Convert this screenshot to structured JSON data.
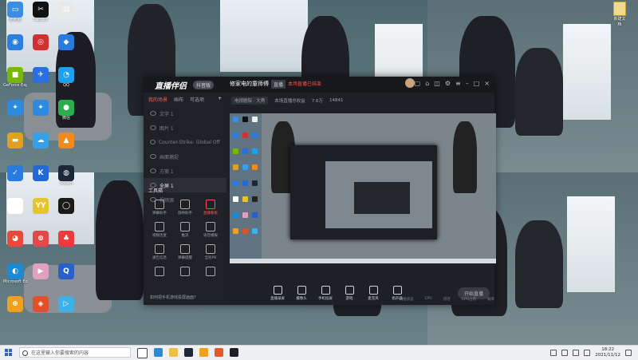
{
  "desktop": {
    "icons": [
      {
        "label": "此电脑",
        "color": "#3a8de0",
        "glyph": "▭"
      },
      {
        "label": "CapCut",
        "color": "#111111",
        "glyph": "✂"
      },
      {
        "label": "",
        "color": "#e8e8e8",
        "glyph": "▤"
      },
      {
        "label": "",
        "color": "#2b7de0",
        "glyph": "◉"
      },
      {
        "label": "",
        "color": "#d03030",
        "glyph": "◎"
      },
      {
        "label": "",
        "color": "#2a7be0",
        "glyph": "◆"
      },
      {
        "label": "GeForce Experience",
        "color": "#76b900",
        "glyph": "■"
      },
      {
        "label": "",
        "color": "#2a6fe0",
        "glyph": "✈"
      },
      {
        "label": "QQ",
        "color": "#1ea0f0",
        "glyph": "◔"
      },
      {
        "label": "",
        "color": "#2c8ae0",
        "glyph": "✦"
      },
      {
        "label": "",
        "color": "#2c8ae0",
        "glyph": "✦"
      },
      {
        "label": "微信",
        "color": "#2aae4e",
        "glyph": "●"
      },
      {
        "label": "",
        "color": "#e0a020",
        "glyph": "▬"
      },
      {
        "label": "",
        "color": "#36a0e8",
        "glyph": "☁"
      },
      {
        "label": "",
        "color": "#f08a1c",
        "glyph": "▲"
      },
      {
        "label": "",
        "color": "#2a7be0",
        "glyph": "✓"
      },
      {
        "label": "",
        "color": "#2468d8",
        "glyph": "K"
      },
      {
        "label": "Steam",
        "color": "#1b2838",
        "glyph": "◍"
      },
      {
        "label": "",
        "color": "#ffffff",
        "glyph": "✿"
      },
      {
        "label": "",
        "color": "#e6c42a",
        "glyph": "YY"
      },
      {
        "label": "",
        "color": "#1a1a1a",
        "glyph": "◯"
      },
      {
        "label": "",
        "color": "#e84a3a",
        "glyph": "◕"
      },
      {
        "label": "",
        "color": "#e24a4a",
        "glyph": "⊚"
      },
      {
        "label": "",
        "color": "#eb3b3b",
        "glyph": "♣"
      },
      {
        "label": "Microsoft Edge",
        "color": "#1a8ad4",
        "glyph": "◐"
      },
      {
        "label": "",
        "color": "#e0a0c0",
        "glyph": "▶"
      },
      {
        "label": "",
        "color": "#2a5ec8",
        "glyph": "Q"
      },
      {
        "label": "",
        "color": "#f0a020",
        "glyph": "⊕"
      },
      {
        "label": "",
        "color": "#e0502a",
        "glyph": "◈"
      },
      {
        "label": "",
        "color": "#3fb0e8",
        "glyph": "▷"
      }
    ],
    "corner_icon_label": "新建文档"
  },
  "app": {
    "logo": "直播伴侣",
    "version_badge": "抖音版",
    "project_title": "修家电的童师傅",
    "tag1": "直播",
    "tag2": "本场直播已结束",
    "left_tabs": [
      "我的场景",
      "画布",
      "可选项"
    ],
    "scenes": [
      "文字 1",
      "图片 1",
      "Counter-Strike: Global Offensive",
      "画面捕捉",
      "方案 1",
      "全屏 1",
      "视频源"
    ],
    "toolbox_title": "工具箱",
    "tools": [
      "弹幕助手",
      "放映助手",
      "直播看板",
      "视频连麦",
      "推流",
      "语音播报",
      "通告信息",
      "弹幕提醒",
      "全民PK",
      "",
      "",
      ""
    ],
    "left_bottom_hint": "如何把手机游戏投屏画面?",
    "infobar": {
      "left": "电视剧院 · 大秀",
      "mid": "本场直播总收益",
      "viewers": "7.6万",
      "likes": "14841"
    },
    "bottom_buttons": [
      "直播录屏",
      "摄像头",
      "手机投屏",
      "游戏",
      "麦克风",
      "扬声器"
    ],
    "live_button": "开始直播",
    "status_items": [
      "网络状态",
      "CPU",
      "内存",
      "CPU占用",
      "帧率"
    ]
  },
  "taskbar": {
    "search_placeholder": "在这里输入你要搜索的内容",
    "time": "18:22",
    "date": "2021/11/12"
  }
}
